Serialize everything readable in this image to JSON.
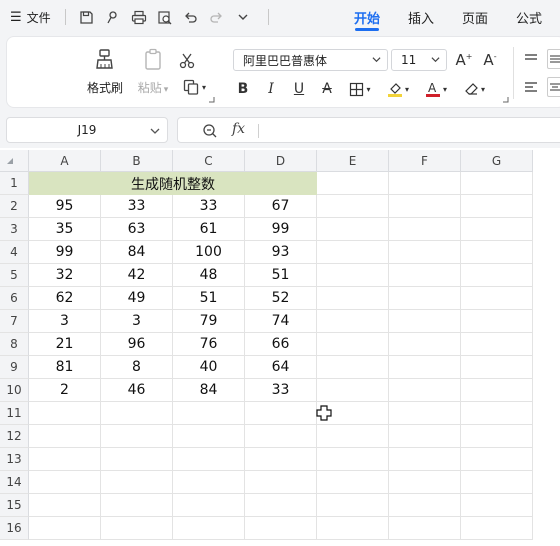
{
  "menu": {
    "file_label": "文件",
    "tabs": [
      {
        "label": "开始",
        "active": true
      },
      {
        "label": "插入",
        "active": false
      },
      {
        "label": "页面",
        "active": false
      },
      {
        "label": "公式",
        "active": false
      }
    ]
  },
  "ribbon": {
    "format_painter_label": "格式刷",
    "paste_label": "粘贴",
    "font_name": "阿里巴巴普惠体",
    "font_size": "11"
  },
  "formula_bar": {
    "name_box": "J19",
    "fx_label": "fx",
    "formula_value": ""
  },
  "sheet": {
    "columns": [
      "A",
      "B",
      "C",
      "D",
      "E",
      "F",
      "G"
    ],
    "row_numbers": [
      "1",
      "2",
      "3",
      "4",
      "5",
      "6",
      "7",
      "8",
      "9",
      "10",
      "11",
      "12",
      "13",
      "14",
      "15",
      "16"
    ],
    "merged_header": "生成随机整数",
    "merged_header_fill": "#d9e4c0",
    "data_rows": [
      [
        "95",
        "33",
        "33",
        "67"
      ],
      [
        "35",
        "63",
        "61",
        "99"
      ],
      [
        "99",
        "84",
        "100",
        "93"
      ],
      [
        "32",
        "42",
        "48",
        "51"
      ],
      [
        "62",
        "49",
        "51",
        "52"
      ],
      [
        "3",
        "3",
        "79",
        "74"
      ],
      [
        "21",
        "96",
        "76",
        "66"
      ],
      [
        "81",
        "8",
        "40",
        "64"
      ],
      [
        "2",
        "46",
        "84",
        "33"
      ]
    ]
  },
  "colors": {
    "accent": "#1d6ef0",
    "font_color_bar": "#d0202a"
  }
}
